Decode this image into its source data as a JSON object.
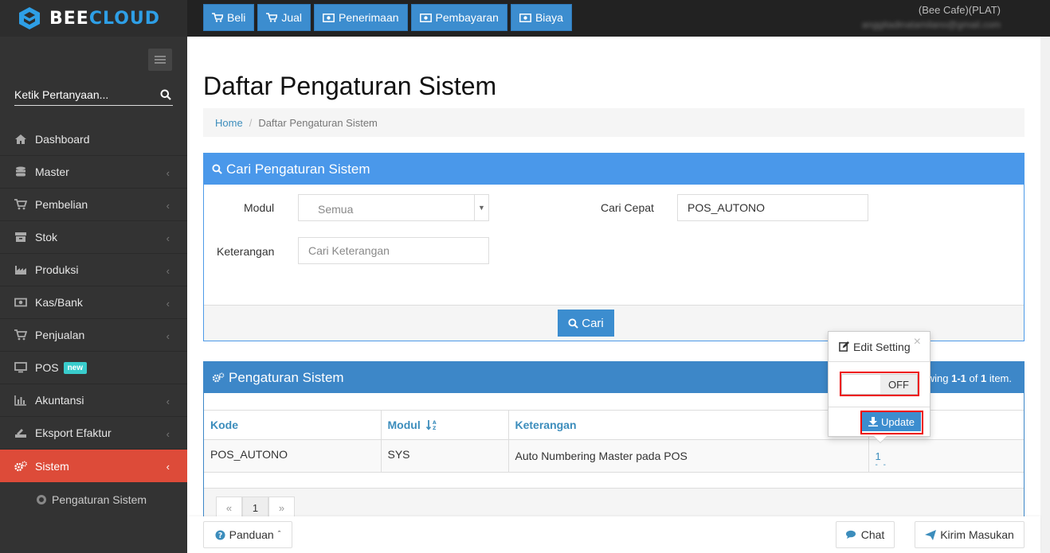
{
  "app": {
    "logo_part1": "BEE",
    "logo_part2": "CLOUD",
    "brand_color": "#2e9fe6"
  },
  "topnav": [
    {
      "label": "Beli",
      "icon": "cart-icon"
    },
    {
      "label": "Jual",
      "icon": "cart-icon"
    },
    {
      "label": "Penerimaan",
      "icon": "money-icon"
    },
    {
      "label": "Pembayaran",
      "icon": "money-icon"
    },
    {
      "label": "Biaya",
      "icon": "money-icon"
    }
  ],
  "user": {
    "company": "(Bee Cafe)(PLAT)",
    "email": "anggitadinatamilano@gmail.com"
  },
  "sidebar": {
    "search_placeholder": "Ketik Pertanyaan...",
    "items": [
      {
        "label": "Dashboard",
        "icon": "home-icon"
      },
      {
        "label": "Master",
        "icon": "database-icon"
      },
      {
        "label": "Pembelian",
        "icon": "cart-icon"
      },
      {
        "label": "Stok",
        "icon": "box-icon"
      },
      {
        "label": "Produksi",
        "icon": "factory-icon"
      },
      {
        "label": "Kas/Bank",
        "icon": "money-icon"
      },
      {
        "label": "Penjualan",
        "icon": "cart-icon"
      },
      {
        "label": "POS",
        "icon": "monitor-icon",
        "badge": "new"
      },
      {
        "label": "Akuntansi",
        "icon": "bar-chart-icon"
      },
      {
        "label": "Eksport Efaktur",
        "icon": "export-icon"
      },
      {
        "label": "Sistem",
        "icon": "gears-icon",
        "active": true
      }
    ],
    "sub_items": [
      {
        "label": "Pengaturan Sistem"
      }
    ],
    "active_color": "#dd4b39"
  },
  "page": {
    "title": "Daftar Pengaturan Sistem",
    "breadcrumb": {
      "home": "Home",
      "current": "Daftar Pengaturan Sistem"
    }
  },
  "search_panel": {
    "title": "Cari Pengaturan Sistem",
    "modul_label": "Modul",
    "modul_value": "Semua",
    "cari_cepat_label": "Cari Cepat",
    "cari_cepat_value": "POS_AUTONO",
    "keterangan_label": "Keterangan",
    "keterangan_placeholder": "Cari Keterangan",
    "search_button": "Cari"
  },
  "results_panel": {
    "title": "Pengaturan Sistem",
    "showing_prefix": "wing ",
    "showing_range": "1-1",
    "showing_of": " of ",
    "showing_total": "1",
    "showing_suffix": " item.",
    "columns": [
      "Kode",
      "Modul",
      "Keterangan"
    ],
    "rows": [
      {
        "kode": "POS_AUTONO",
        "modul": "SYS",
        "keterangan": "Auto Numbering Master pada POS",
        "value": "1",
        "dash": "- -"
      }
    ],
    "pager": {
      "prev": "«",
      "page": "1",
      "next": "»"
    }
  },
  "popover": {
    "title": "Edit Setting",
    "close": "×",
    "switch_state": "OFF",
    "update_button": "Update"
  },
  "bottom": {
    "panduan": "Panduan",
    "chat": "Chat",
    "kirim": "Kirim Masukan"
  }
}
